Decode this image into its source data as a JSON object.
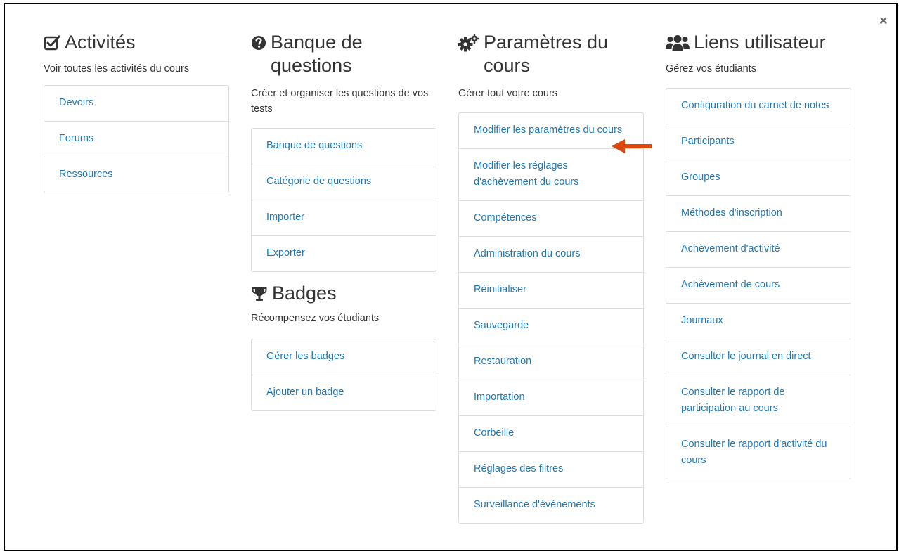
{
  "close_label": "×",
  "activites": {
    "title": "Activités",
    "description": "Voir toutes les activités du cours",
    "items": [
      "Devoirs",
      "Forums",
      "Ressources"
    ]
  },
  "banque": {
    "title_line1": "Banque de",
    "title_line2": "questions",
    "description": "Créer et organiser les questions de vos tests",
    "items": [
      "Banque de questions",
      "Catégorie de questions",
      "Importer",
      "Exporter"
    ]
  },
  "badges": {
    "title": "Badges",
    "description": "Récompensez vos étudiants",
    "items": [
      "Gérer les badges",
      "Ajouter un badge"
    ]
  },
  "parametres": {
    "title_line1": "Paramètres du",
    "title_line2": "cours",
    "description": "Gérer tout votre cours",
    "items": [
      "Modifier les paramètres du cours",
      "Modifier les réglages d'achèvement du cours",
      "Compétences",
      "Administration du cours",
      "Réinitialiser",
      "Sauvegarde",
      "Restauration",
      "Importation",
      "Corbeille",
      "Réglages des filtres",
      "Surveillance d'événements"
    ]
  },
  "liens": {
    "title": "Liens utilisateur",
    "description": "Gérez vos étudiants",
    "items": [
      "Configuration du carnet de notes",
      "Participants",
      "Groupes",
      "Méthodes d'inscription",
      "Achèvement d'activité",
      "Achèvement de cours",
      "Journaux",
      "Consulter le journal en direct",
      "Consulter le rapport de participation au cours",
      "Consulter le rapport d'activité du cours"
    ]
  },
  "colors": {
    "link": "#1f78b4",
    "text": "#333333",
    "border": "#dcdcdc",
    "arrow": "#d9480f"
  },
  "icons": {
    "activites": "check-square-icon",
    "banque": "question-circle-icon",
    "badges": "trophy-icon",
    "parametres": "gears-icon",
    "liens": "users-icon",
    "close": "close-icon",
    "pointer": "arrow-left-icon"
  }
}
